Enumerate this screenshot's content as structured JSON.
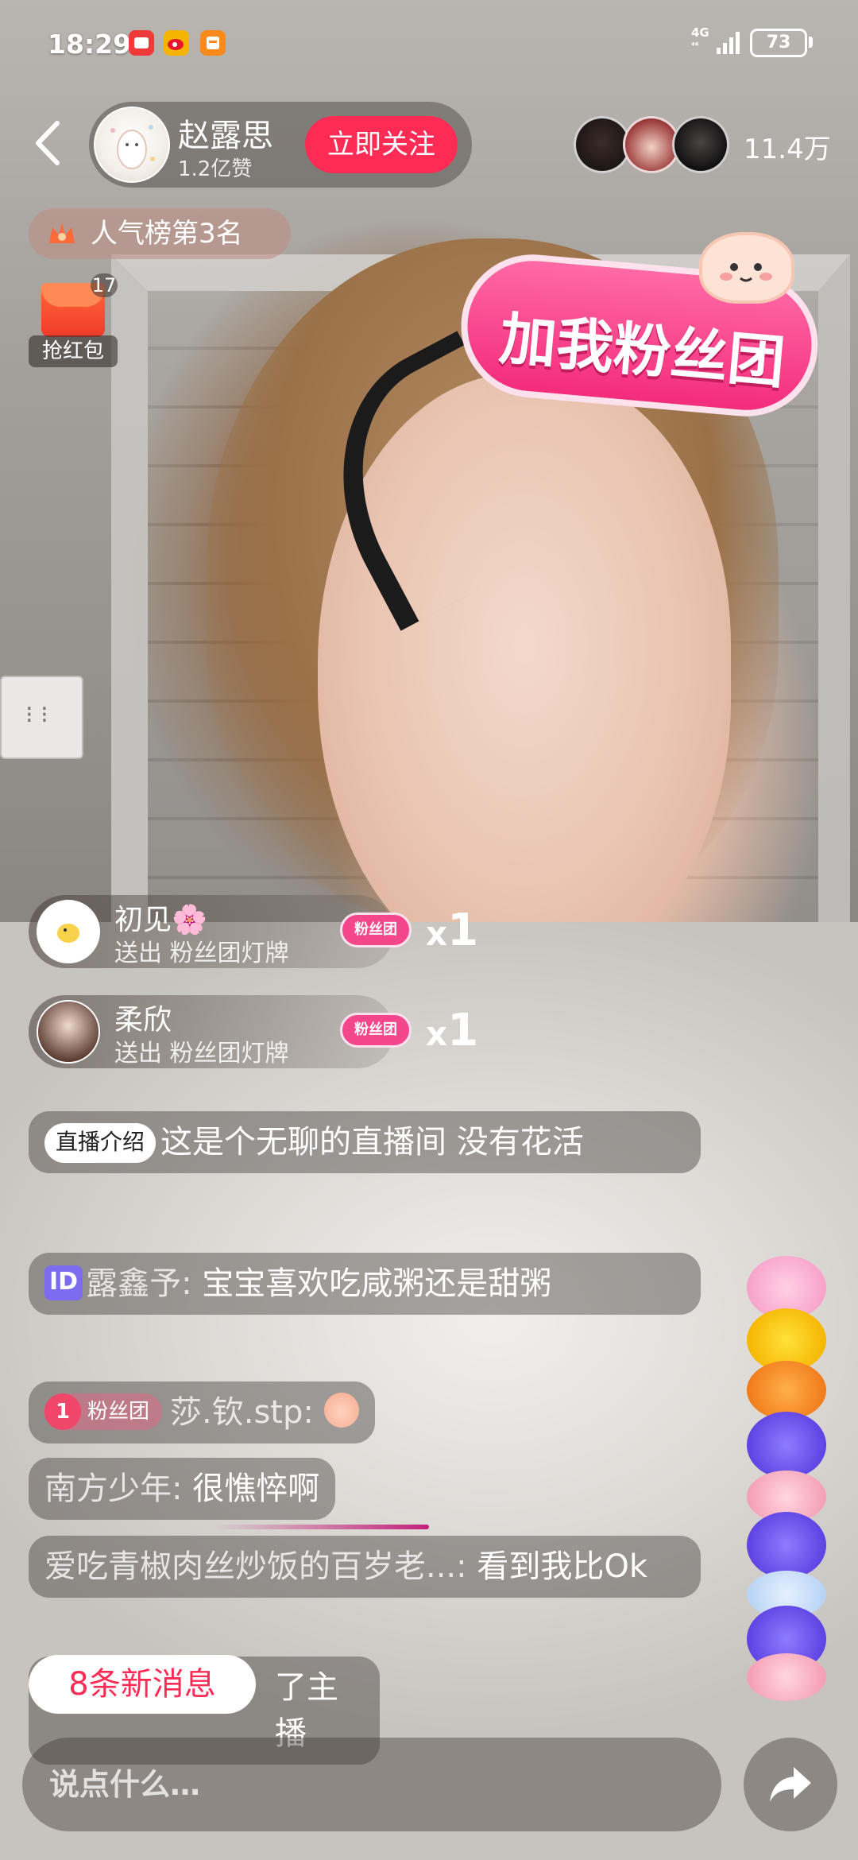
{
  "status_bar": {
    "time": "18:29",
    "network": "4G",
    "network_sub": "⁴⁶",
    "battery": "73",
    "notification_icons": [
      "red-app-icon",
      "weibo-icon",
      "orange-app-icon"
    ]
  },
  "host": {
    "name": "赵露思",
    "likes": "1.2亿赞",
    "follow_label": "立即关注",
    "viewer_count": "11.4万"
  },
  "rank_badge": {
    "label": "人气榜第3名"
  },
  "red_packet": {
    "count": "17",
    "label": "抢红包"
  },
  "fan_club_sticker": {
    "text": "加我粉丝团"
  },
  "gifts": [
    {
      "user": "初见🌸",
      "action": "送出 粉丝团灯牌",
      "gift_label": "粉丝团",
      "x": "x",
      "count": "1"
    },
    {
      "user": "柔欣",
      "action": "送出 粉丝团灯牌",
      "gift_label": "粉丝团",
      "x": "x",
      "count": "1"
    }
  ],
  "chat": {
    "intro": {
      "tag": "直播介绍",
      "text": "这是个无聊的直播间 没有花活"
    },
    "messages": [
      {
        "badge": "ID",
        "user": "露鑫予:",
        "text": "宝宝喜欢吃咸粥还是甜粥"
      },
      {
        "fan_level": "1",
        "fan_label": "粉丝团",
        "user": "莎.钦.stp:",
        "text": ""
      },
      {
        "user": "南方少年:",
        "text": "很憔悴啊"
      },
      {
        "user": "爱吃青椒肉丝炒饭的百岁老...:",
        "text": "看到我比Ok"
      },
      {
        "user": "",
        "text": "了主播"
      }
    ],
    "new_messages_label": "8条新消息"
  },
  "bottom_bar": {
    "input_placeholder": "说点什么…"
  },
  "colors": {
    "accent": "#fe2c55",
    "fan_pink": "#f4468b"
  }
}
